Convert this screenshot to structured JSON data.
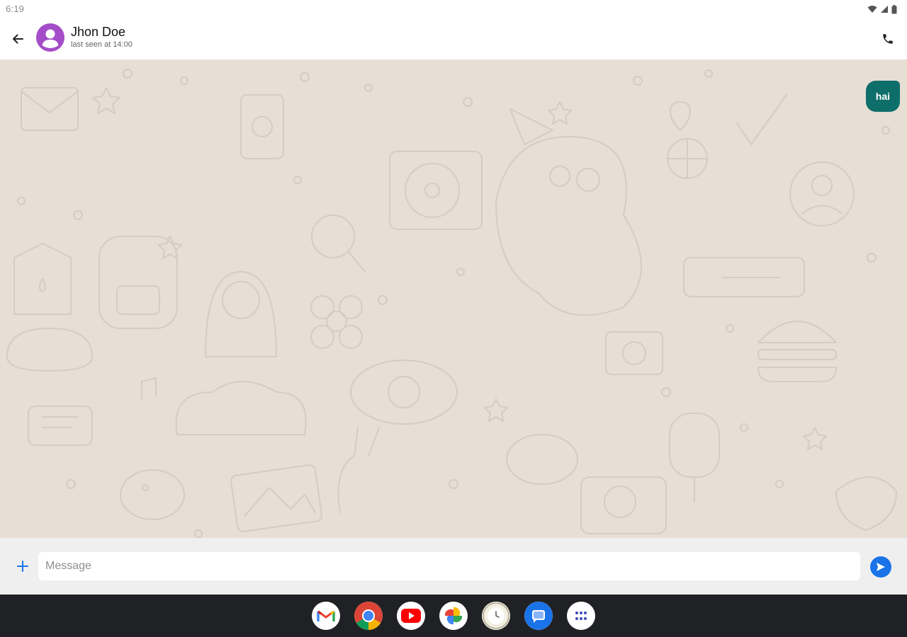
{
  "status_bar": {
    "time": "6:19",
    "icons": [
      "wifi-icon",
      "signal-icon",
      "battery-icon"
    ]
  },
  "header": {
    "contact_name": "Jhon Doe",
    "contact_status": "last seen at 14:00",
    "avatar_color": "#a54dc8"
  },
  "chat": {
    "background_color": "#e7ded4",
    "messages": [
      {
        "text": "hai",
        "direction": "outgoing",
        "bubble_color": "#0e6e6a"
      }
    ]
  },
  "composer": {
    "placeholder": "Message",
    "value": "",
    "send_color": "#1a73e8"
  },
  "taskbar": {
    "apps": [
      "Gmail",
      "Chrome",
      "YouTube",
      "Photos",
      "Clock",
      "Messages",
      "App Launcher"
    ]
  }
}
